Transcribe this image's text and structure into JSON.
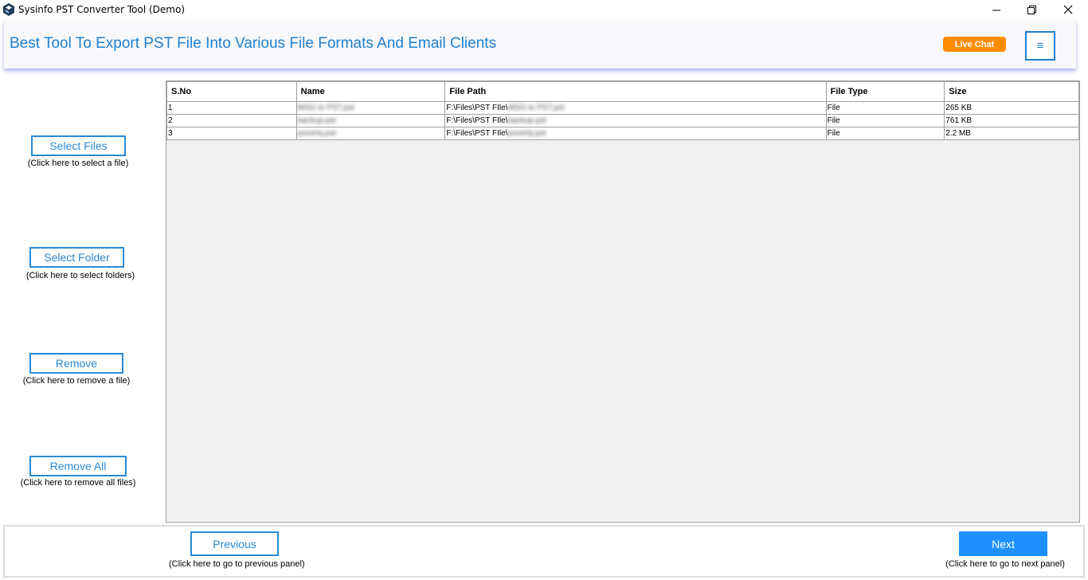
{
  "window": {
    "title": "Sysinfo PST Converter Tool (Demo)",
    "minimize_glyph": "—",
    "maximize_glyph": "❐",
    "close_glyph": "✕"
  },
  "header": {
    "title": "Best Tool To Export PST File Into Various File Formats And Email Clients",
    "live_chat_label": "Live Chat",
    "menu_glyph": "≡",
    "accent_color": "#1e7fcf",
    "live_chat_color": "#ff8c00"
  },
  "left_panel": {
    "select_files": {
      "label": "Select Files",
      "hint": "(Click here to select a file)"
    },
    "select_folder": {
      "label": "Select Folder",
      "hint": "(Click here to select folders)"
    },
    "remove": {
      "label": "Remove",
      "hint": "(Click here to remove a file)"
    },
    "remove_all": {
      "label": "Remove All",
      "hint": "(Click here to remove all files)"
    }
  },
  "table": {
    "columns": [
      "S.No",
      "Name",
      "File Path",
      "File Type",
      "Size"
    ],
    "rows": [
      {
        "sno": "1",
        "name": "MSG to PST.pst",
        "path_prefix": "F:\\Files\\PST FIle\\",
        "path_file": "MSG to PST.pst",
        "type": "File",
        "size": "265 KB"
      },
      {
        "sno": "2",
        "name": "backup.pst",
        "path_prefix": "F:\\Files\\PST FIle\\",
        "path_file": "backup.pst",
        "type": "File",
        "size": "761 KB"
      },
      {
        "sno": "3",
        "name": "poverty.pst",
        "path_prefix": "F:\\Files\\PST FIle\\",
        "path_file": "poverty.pst",
        "type": "File",
        "size": "2.2 MB"
      }
    ]
  },
  "footer": {
    "previous_label": "Previous",
    "previous_hint": "(Click here to go to previous panel)",
    "next_label": "Next",
    "next_hint": "(Click here to go to next panel)",
    "next_color": "#1e90ff"
  }
}
